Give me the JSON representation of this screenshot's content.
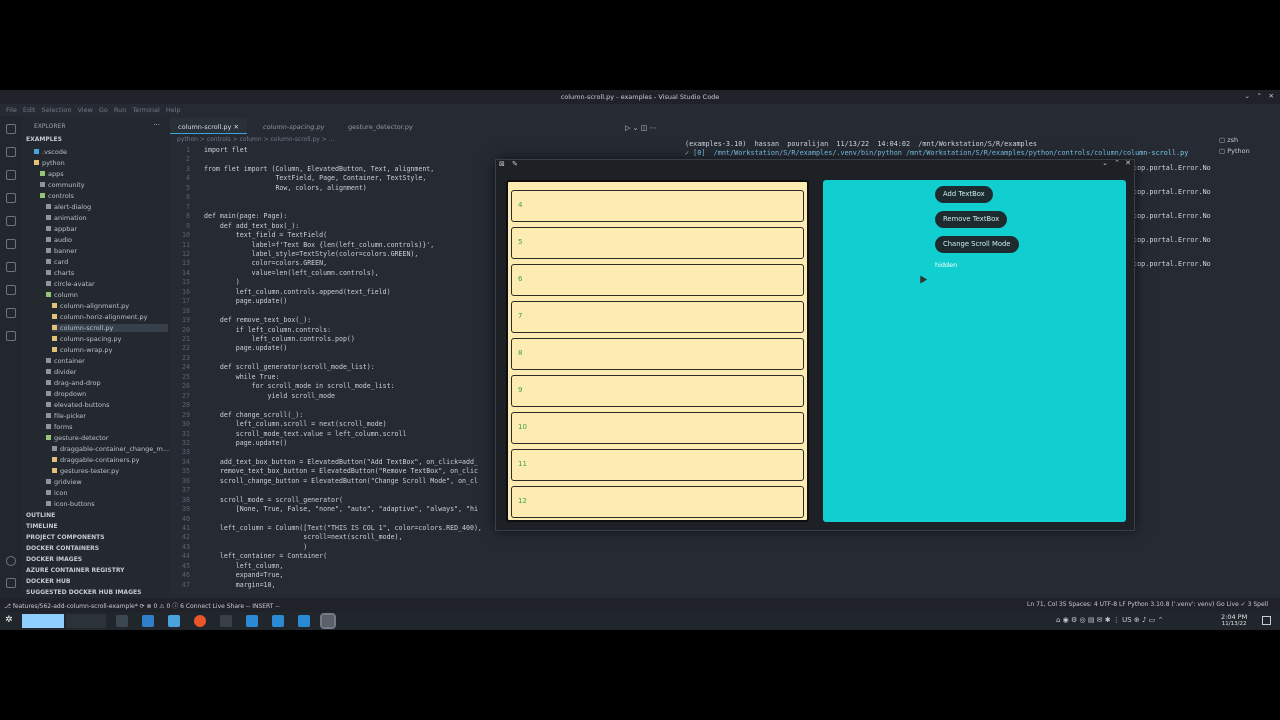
{
  "window": {
    "title": "column-scroll.py - examples - Visual Studio Code"
  },
  "menu": [
    "File",
    "Edit",
    "Selection",
    "View",
    "Go",
    "Run",
    "Terminal",
    "Help"
  ],
  "explorer": {
    "header": "EXPLORER",
    "root": "EXAMPLES",
    "items": [
      ".vscode",
      "python",
      "apps",
      "community",
      "controls",
      "alert-dialog",
      "animation",
      "appbar",
      "audio",
      "banner",
      "card",
      "charts",
      "circle-avatar",
      "column",
      "column-alignment.py",
      "column-horiz-alignment.py",
      "column-scroll.py",
      "column-spacing.py",
      "column-wrap.py",
      "container",
      "divider",
      "drag-and-drop",
      "dropdown",
      "elevated-buttons",
      "file-picker",
      "forms",
      "gesture-detector",
      "draggable-container_change_m...",
      "draggable-containers.py",
      "gestures-tester.py",
      "gridview",
      "icon",
      "icon-buttons"
    ],
    "sections": [
      "OUTLINE",
      "TIMELINE",
      "PROJECT COMPONENTS",
      "DOCKER CONTAINERS",
      "DOCKER IMAGES",
      "AZURE CONTAINER REGISTRY",
      "DOCKER HUB",
      "SUGGESTED DOCKER HUB IMAGES"
    ]
  },
  "tabs": [
    "column-scroll.py",
    "column-spacing.py",
    "gesture_detector.py"
  ],
  "breadcrumb": "python > controls > column > column-scroll.py > ...",
  "code": [
    {
      "n": "1",
      "t": "import flet"
    },
    {
      "n": "2",
      "t": ""
    },
    {
      "n": "3",
      "t": "from flet import (Column, ElevatedButton, Text, alignment,"
    },
    {
      "n": "4",
      "t": "                  TextField, Page, Container, TextStyle,"
    },
    {
      "n": "5",
      "t": "                  Row, colors, alignment)"
    },
    {
      "n": "6",
      "t": ""
    },
    {
      "n": "7",
      "t": ""
    },
    {
      "n": "8",
      "t": "def main(page: Page):"
    },
    {
      "n": "9",
      "t": "    def add_text_box(_):"
    },
    {
      "n": "10",
      "t": "        text_field = TextField("
    },
    {
      "n": "11",
      "t": "            label=f'Text Box {len(left_column.controls)}',"
    },
    {
      "n": "12",
      "t": "            label_style=TextStyle(color=colors.GREEN),"
    },
    {
      "n": "13",
      "t": "            color=colors.GREEN,"
    },
    {
      "n": "14",
      "t": "            value=len(left_column.controls),"
    },
    {
      "n": "15",
      "t": "        )"
    },
    {
      "n": "16",
      "t": "        left_column.controls.append(text_field)"
    },
    {
      "n": "17",
      "t": "        page.update()"
    },
    {
      "n": "18",
      "t": ""
    },
    {
      "n": "19",
      "t": "    def remove_text_box(_):"
    },
    {
      "n": "20",
      "t": "        if left_column.controls:"
    },
    {
      "n": "21",
      "t": "            left_column.controls.pop()"
    },
    {
      "n": "22",
      "t": "        page.update()"
    },
    {
      "n": "23",
      "t": ""
    },
    {
      "n": "24",
      "t": "    def scroll_generator(scroll_mode_list):"
    },
    {
      "n": "25",
      "t": "        while True:"
    },
    {
      "n": "26",
      "t": "            for scroll_mode in scroll_mode_list:"
    },
    {
      "n": "27",
      "t": "                yield scroll_mode"
    },
    {
      "n": "28",
      "t": ""
    },
    {
      "n": "29",
      "t": "    def change_scroll(_):"
    },
    {
      "n": "30",
      "t": "        left_column.scroll = next(scroll_mode)"
    },
    {
      "n": "31",
      "t": "        scroll_mode_text.value = left_column.scroll"
    },
    {
      "n": "32",
      "t": "        page.update()"
    },
    {
      "n": "33",
      "t": ""
    },
    {
      "n": "34",
      "t": "    add_text_box_button = ElevatedButton(\"Add TextBox\", on_click=add_"
    },
    {
      "n": "35",
      "t": "    remove_text_box_button = ElevatedButton(\"Remove TextBox\", on_clic"
    },
    {
      "n": "36",
      "t": "    scroll_change_button = ElevatedButton(\"Change Scroll Mode\", on_cl"
    },
    {
      "n": "37",
      "t": ""
    },
    {
      "n": "38",
      "t": "    scroll_mode = scroll_generator("
    },
    {
      "n": "39",
      "t": "        [None, True, False, \"none\", \"auto\", \"adaptive\", \"always\", \"hi"
    },
    {
      "n": "40",
      "t": ""
    },
    {
      "n": "41",
      "t": "    left_column = Column([Text(\"THIS IS COL 1\", color=colors.RED_400),"
    },
    {
      "n": "42",
      "t": "                         scroll=next(scroll_mode),"
    },
    {
      "n": "43",
      "t": "                         )"
    },
    {
      "n": "44",
      "t": "    left_container = Container("
    },
    {
      "n": "45",
      "t": "        left_column,"
    },
    {
      "n": "46",
      "t": "        expand=True,"
    },
    {
      "n": "47",
      "t": "        margin=10,"
    }
  ],
  "terminal": {
    "prompt": "(examples-3.10)  hassan  pouralijan  11/13/22  14:04:02  /mnt/Workstation/S/R/examples",
    "command": "✓ [0]  /mnt/Workstation/S/R/examples/.venv/bin/python /mnt/Workstation/S/R/examples/python/controls/column/column-scroll.py",
    "errors": [
      "top.portal.Error.No",
      "top.portal.Error.No",
      "top.portal.Error.No",
      "top.portal.Error.No",
      "top.portal.Error.No"
    ]
  },
  "terminal_list": [
    "zsh",
    "Python"
  ],
  "flet_app": {
    "textboxes": [
      "4",
      "5",
      "6",
      "7",
      "8",
      "9",
      "10",
      "11",
      "12"
    ],
    "buttons": [
      "Add TextBox",
      "Remove TextBox",
      "Change Scroll Mode"
    ],
    "scroll_mode_text": "hidden",
    "colors": {
      "left_bg": "#fdecb1",
      "right_bg": "#11cfd1",
      "label": "#43a047"
    }
  },
  "status": {
    "left": "⎇ features/562-add-column-scroll-example*   ⟳   ⊗ 0 ⚠ 0 ⓘ 6   Connect   Live Share   -- INSERT --",
    "right": "Ln 71, Col 35   Spaces: 4   UTF-8   LF   Python   3.10.8 ('.venv': venv)   Go Live   ✓ 3 Spell"
  },
  "clock": {
    "time": "2:04 PM",
    "date": "11/13/22",
    "kb": "US"
  }
}
